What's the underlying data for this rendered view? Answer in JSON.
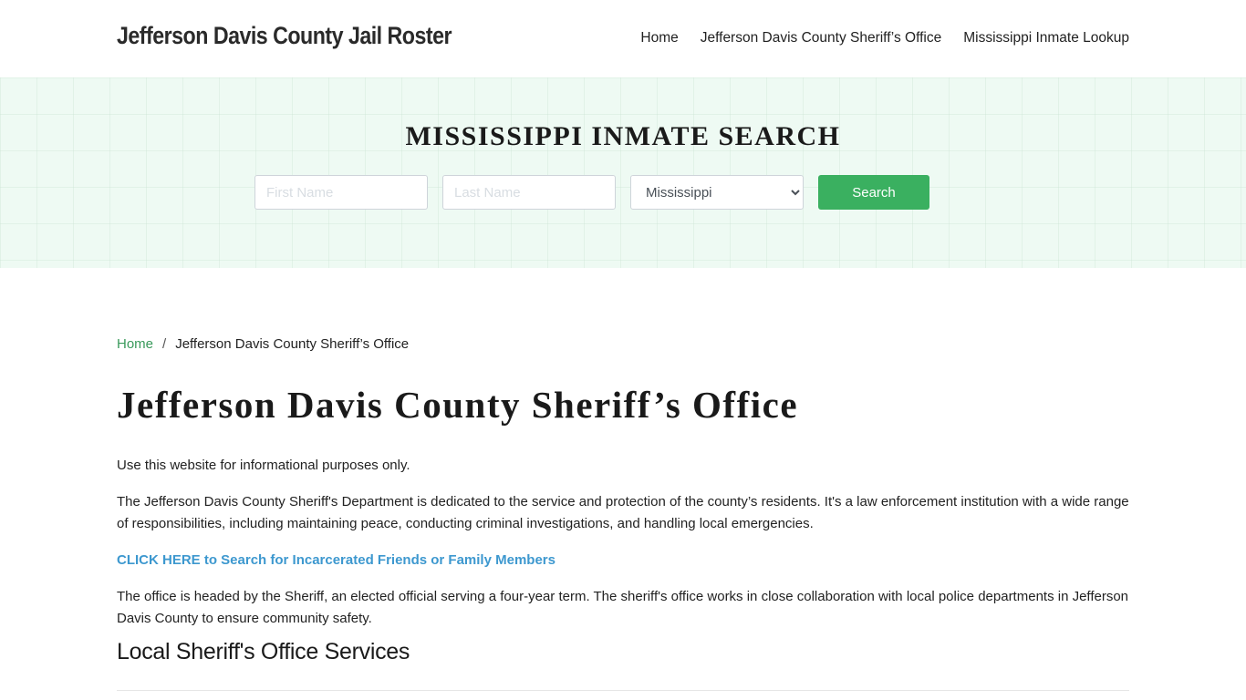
{
  "header": {
    "brand": "Jefferson Davis County Jail Roster",
    "nav": [
      {
        "label": "Home"
      },
      {
        "label": "Jefferson Davis County Sheriff’s Office"
      },
      {
        "label": "Mississippi Inmate Lookup"
      }
    ]
  },
  "hero": {
    "title": "MISSISSIPPI INMATE SEARCH",
    "first_name_placeholder": "First Name",
    "last_name_placeholder": "Last Name",
    "state_selected": "Mississippi",
    "search_label": "Search"
  },
  "breadcrumb": {
    "home": "Home",
    "separator": "/",
    "current": "Jefferson Davis County Sheriff’s Office"
  },
  "main": {
    "title": "Jefferson Davis County Sheriff’s Office",
    "paragraphs": [
      "Use this website for informational purposes only.",
      "The Jefferson Davis County Sheriff's Department is dedicated to the service and protection of the county’s residents. It's a law enforcement institution with a wide range of responsibilities, including maintaining peace, conducting criminal investigations, and handling local emergencies.",
      "The office is headed by the Sheriff, an elected official serving a four-year term. The sheriff's office works in close collaboration with local police departments in Jefferson Davis County to ensure community safety."
    ],
    "cta_link": "CLICK HERE to Search for Incarcerated Friends or Family Members",
    "section_heading": "Local Sheriff's Office Services"
  },
  "colors": {
    "accent_green": "#3ab060",
    "link_blue": "#3d98cf",
    "breadcrumb_green": "#3a9a5c",
    "hero_bg": "#eefaf3"
  }
}
